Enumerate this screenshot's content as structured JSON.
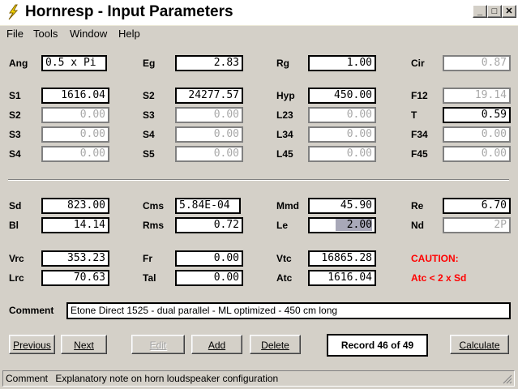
{
  "window": {
    "title": "Hornresp - Input Parameters",
    "minimize_glyph": "_",
    "maximize_glyph": "□",
    "close_glyph": "✕"
  },
  "menu": [
    "File",
    "Tools",
    "Window",
    "Help"
  ],
  "fields": {
    "Ang": {
      "label": "Ang",
      "value": "0.5 x Pi"
    },
    "Eg": {
      "label": "Eg",
      "value": "2.83"
    },
    "Rg": {
      "label": "Rg",
      "value": "1.00"
    },
    "Cir": {
      "label": "Cir",
      "value": "0.87"
    },
    "S1": {
      "label": "S1",
      "value": "1616.04"
    },
    "S2b": {
      "label": "S2",
      "value": "24277.57"
    },
    "Hyp": {
      "label": "Hyp",
      "value": "450.00"
    },
    "F12": {
      "label": "F12",
      "value": "19.14"
    },
    "S2": {
      "label": "S2",
      "value": "0.00"
    },
    "S3b": {
      "label": "S3",
      "value": "0.00"
    },
    "L23": {
      "label": "L23",
      "value": "0.00"
    },
    "T": {
      "label": "T",
      "value": "0.59"
    },
    "S3": {
      "label": "S3",
      "value": "0.00"
    },
    "S4b": {
      "label": "S4",
      "value": "0.00"
    },
    "L34": {
      "label": "L34",
      "value": "0.00"
    },
    "F34": {
      "label": "F34",
      "value": "0.00"
    },
    "S4": {
      "label": "S4",
      "value": "0.00"
    },
    "S5": {
      "label": "S5",
      "value": "0.00"
    },
    "L45": {
      "label": "L45",
      "value": "0.00"
    },
    "F45": {
      "label": "F45",
      "value": "0.00"
    },
    "Sd": {
      "label": "Sd",
      "value": "823.00"
    },
    "Cms": {
      "label": "Cms",
      "value": "5.84E-04"
    },
    "Mmd": {
      "label": "Mmd",
      "value": "45.90"
    },
    "Re": {
      "label": "Re",
      "value": "6.70"
    },
    "Bl": {
      "label": "Bl",
      "value": "14.14"
    },
    "Rms": {
      "label": "Rms",
      "value": "0.72"
    },
    "Le": {
      "label": "Le",
      "value": "2.00"
    },
    "Nd": {
      "label": "Nd",
      "value": "2P"
    },
    "Vrc": {
      "label": "Vrc",
      "value": "353.23"
    },
    "Fr": {
      "label": "Fr",
      "value": "0.00"
    },
    "Vtc": {
      "label": "Vtc",
      "value": "16865.28"
    },
    "Lrc": {
      "label": "Lrc",
      "value": "70.63"
    },
    "Tal": {
      "label": "Tal",
      "value": "0.00"
    },
    "Atc": {
      "label": "Atc",
      "value": "1616.04"
    }
  },
  "caution": {
    "title": "CAUTION:",
    "message": "Atc < 2 x Sd"
  },
  "comment": {
    "label": "Comment",
    "value": "Etone Direct 1525 - dual parallel - ML optimized - 450 cm long"
  },
  "buttons": {
    "previous": "Previous",
    "next": "Next",
    "edit": "Edit",
    "add": "Add",
    "delete": "Delete",
    "calculate": "Calculate"
  },
  "record": "Record 46 of 49",
  "status": {
    "field": "Comment",
    "text": "Explanatory note on horn loudspeaker configuration"
  },
  "colors": {
    "caution": "#ff0000",
    "face": "#d4d0c8",
    "disabled_text": "#a8a8a8"
  }
}
